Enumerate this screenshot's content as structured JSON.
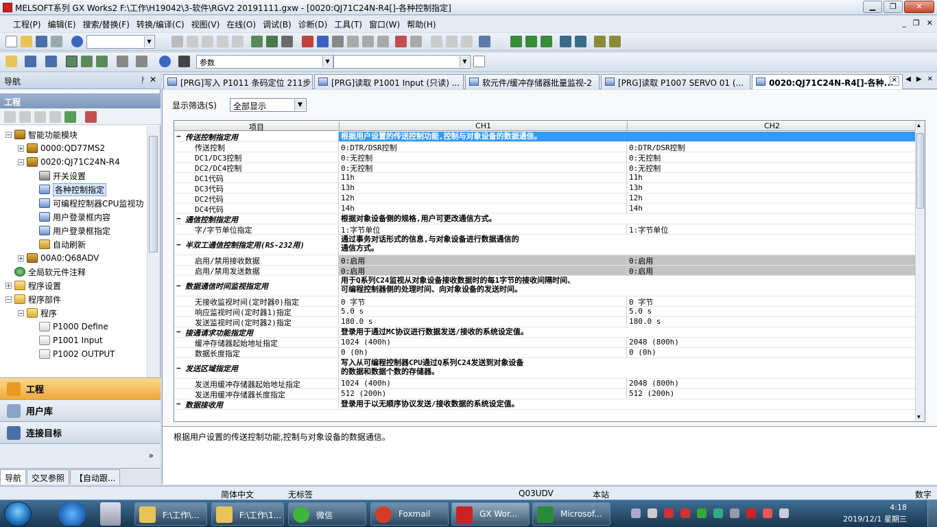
{
  "window": {
    "title": "MELSOFT系列 GX Works2 F:\\工作\\H19042\\3-软件\\RGV2 20191111.gxw - [0020:QJ71C24N-R4[]-各种控制指定]"
  },
  "menu": [
    "工程(P)",
    "编辑(E)",
    "搜索/替换(F)",
    "转换/编译(C)",
    "视图(V)",
    "在线(O)",
    "调试(B)",
    "诊断(D)",
    "工具(T)",
    "窗口(W)",
    "帮助(H)"
  ],
  "toolbar": {
    "combo2_value": "参数"
  },
  "nav": {
    "title": "导航",
    "section": "工程",
    "tree": [
      {
        "label": "智能功能模块",
        "exp": "−",
        "icon": "mod",
        "level": 0
      },
      {
        "label": "0000:QD77MS2",
        "exp": "+",
        "icon": "mod",
        "level": 1
      },
      {
        "label": "0020:QJ71C24N-R4",
        "exp": "−",
        "icon": "mod",
        "level": 1
      },
      {
        "label": "开关设置",
        "exp": "",
        "icon": "sw",
        "level": 2
      },
      {
        "label": "各种控制指定",
        "exp": "",
        "icon": "param",
        "level": 2,
        "selected": true
      },
      {
        "label": "可编程控制器CPU监视功",
        "exp": "",
        "icon": "param",
        "level": 2
      },
      {
        "label": "用户登录框内容",
        "exp": "",
        "icon": "param",
        "level": 2
      },
      {
        "label": "用户登录框指定",
        "exp": "",
        "icon": "param",
        "level": 2
      },
      {
        "label": "自动刷新",
        "exp": "",
        "icon": "refr",
        "level": 2
      },
      {
        "label": "00A0:Q68ADV",
        "exp": "+",
        "icon": "mod",
        "level": 1
      },
      {
        "label": "全局软元件注释",
        "exp": "",
        "icon": "globe",
        "level": 0
      },
      {
        "label": "程序设置",
        "exp": "+",
        "icon": "fold",
        "level": 0
      },
      {
        "label": "程序部件",
        "exp": "−",
        "icon": "fold",
        "level": 0
      },
      {
        "label": "程序",
        "exp": "−",
        "icon": "fold",
        "level": 1
      },
      {
        "label": "P1000 Define",
        "exp": "",
        "icon": "prog",
        "level": 2
      },
      {
        "label": "P1001 Input",
        "exp": "",
        "icon": "prog",
        "level": 2
      },
      {
        "label": "P1002 OUTPUT",
        "exp": "",
        "icon": "prog",
        "level": 2
      }
    ],
    "buttons": {
      "project": "工程",
      "library": "用户库",
      "connection": "连接目标"
    },
    "bottom_tabs": [
      "导航",
      "交叉参照",
      "【自动跟..."
    ]
  },
  "tabs": [
    {
      "label": "[PRG]写入 P1011 条码定位 211步",
      "active": false
    },
    {
      "label": "[PRG]读取 P1001 Input (只读) ...",
      "active": false
    },
    {
      "label": "软元件/缓冲存储器批量监视-2",
      "active": false
    },
    {
      "label": "[PRG]读取 P1007 SERVO 01 (...",
      "active": false
    },
    {
      "label": "0020:QJ71C24N-R4[]-各种...",
      "active": true
    }
  ],
  "filter": {
    "label": "显示筛选(S)",
    "value": "全部显示"
  },
  "grid": {
    "headers": [
      "项目",
      "CH1",
      "CH2"
    ],
    "rows": [
      {
        "type": "grp",
        "item": "传送控制指定用",
        "desc": "根据用户设置的传送控制功能,控制与对象设备的数据通信。",
        "selected": true
      },
      {
        "type": "row",
        "item": "传送控制",
        "ch1": "0:DTR/DSR控制",
        "ch2": "0:DTR/DSR控制"
      },
      {
        "type": "row",
        "item": "DC1/DC3控制",
        "ch1": "0:无控制",
        "ch2": "0:无控制"
      },
      {
        "type": "row",
        "item": "DC2/DC4控制",
        "ch1": "0:无控制",
        "ch2": "0:无控制"
      },
      {
        "type": "row",
        "item": "DC1代码",
        "ch1": "11h",
        "ch2": "11h"
      },
      {
        "type": "row",
        "item": "DC3代码",
        "ch1": "13h",
        "ch2": "13h"
      },
      {
        "type": "row",
        "item": "DC2代码",
        "ch1": "12h",
        "ch2": "12h"
      },
      {
        "type": "row",
        "item": "DC4代码",
        "ch1": "14h",
        "ch2": "14h"
      },
      {
        "type": "grp",
        "item": "通信控制指定用",
        "desc": "根据对象设备侧的规格,用户可更改通信方式。"
      },
      {
        "type": "row",
        "item": "字/字节单位指定",
        "ch1": "1:字节单位",
        "ch2": "1:字节单位"
      },
      {
        "type": "grp",
        "item": "半双工通信控制指定用(RS-232用)",
        "desc": "通过事务对话形式的信息,与对象设备进行数据通信的\n通信方式。",
        "tall": true
      },
      {
        "type": "row",
        "item": "启用/禁用接收数据",
        "ch1": "0:启用",
        "ch2": "0:启用",
        "grey": true
      },
      {
        "type": "row",
        "item": "启用/禁用发送数据",
        "ch1": "0:启用",
        "ch2": "0:启用",
        "grey": true
      },
      {
        "type": "grp",
        "item": "数据通信时间监视指定用",
        "desc": "用于Q系列C24监视从对象设备接收数据时的每1字节的接收间隔时间、\n可编程控制器侧的处理时间、向对象设备的发送时间。",
        "tall": true
      },
      {
        "type": "row",
        "item": "无接收监视时间(定时器0)指定",
        "ch1": "0 字节",
        "ch2": "0 字节"
      },
      {
        "type": "row",
        "item": "响应监视时间(定时器1)指定",
        "ch1": "5.0 s",
        "ch2": "5.0 s"
      },
      {
        "type": "row",
        "item": "发送监视时间(定时器2)指定",
        "ch1": "180.0 s",
        "ch2": "180.0 s"
      },
      {
        "type": "grp",
        "item": "接通请求功能指定用",
        "desc": "登录用于通过MC协议进行数据发送/接收的系统设定值。"
      },
      {
        "type": "row",
        "item": "缓冲存储器起始地址指定",
        "ch1": "1024 (400h)",
        "ch2": "2048 (800h)"
      },
      {
        "type": "row",
        "item": "数据长度指定",
        "ch1": "0 (0h)",
        "ch2": "0 (0h)"
      },
      {
        "type": "grp",
        "item": "发送区域指定用",
        "desc": "写入从可编程控制器CPU通过Q系列C24发送到对象设备\n的数据和数据个数的存储器。",
        "tall": true
      },
      {
        "type": "row",
        "item": "发送用缓冲存储器起始地址指定",
        "ch1": "1024 (400h)",
        "ch2": "2048 (800h)"
      },
      {
        "type": "row",
        "item": "发送用缓冲存储器长度指定",
        "ch1": "512 (200h)",
        "ch2": "512 (200h)"
      },
      {
        "type": "grp",
        "item": "数据接收用",
        "desc": "登录用于以无顺序协议发送/接收数据的系统设定值。"
      }
    ]
  },
  "description": "根据用户设置的传送控制功能,控制与对象设备的数据通信。",
  "status": {
    "lang": "简体中文",
    "label": "无标签",
    "cpu": "Q03UDV",
    "station": "本站",
    "mode": "数字"
  },
  "taskbar": {
    "tasks": [
      "F:\\工作\\...",
      "F:\\工作\\1...",
      "微信",
      "Foxmail",
      "GX Wor...",
      "Microsof..."
    ],
    "time": "4:18",
    "date": "2019/12/1 星期三"
  }
}
